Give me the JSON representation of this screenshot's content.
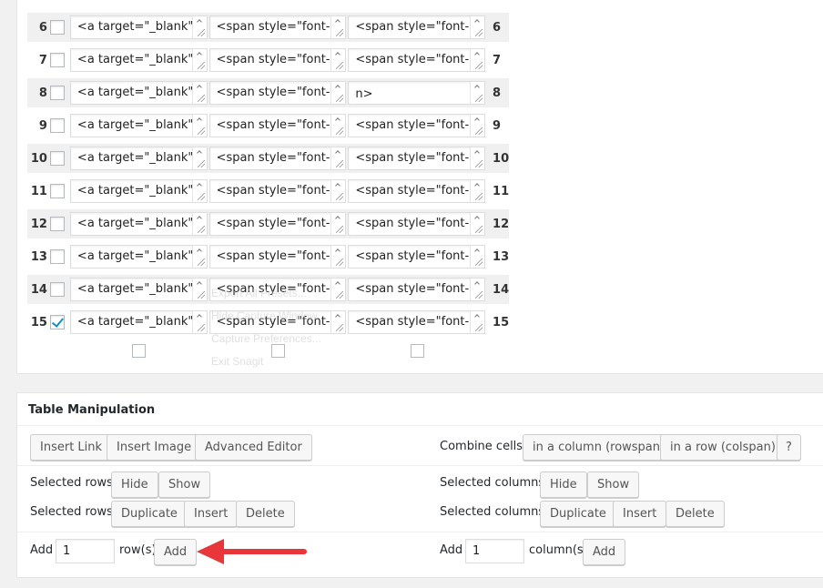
{
  "rows": [
    {
      "num": "6",
      "checked": false,
      "c1": "<a target=\"_blank\"",
      "c2": "<span style=\"font-",
      "c3": "<span style=\"font-"
    },
    {
      "num": "7",
      "checked": false,
      "c1": "<a target=\"_blank\"",
      "c2": "<span style=\"font-",
      "c3": "<span style=\"font-"
    },
    {
      "num": "8",
      "checked": false,
      "c1": "<a target=\"_blank\"",
      "c2": "<span style=\"font-",
      "c3": "n>"
    },
    {
      "num": "9",
      "checked": false,
      "c1": "<a target=\"_blank\"",
      "c2": "<span style=\"font-",
      "c3": "<span style=\"font-"
    },
    {
      "num": "10",
      "checked": false,
      "c1": "<a target=\"_blank\"",
      "c2": "<span style=\"font-",
      "c3": "<span style=\"font-"
    },
    {
      "num": "11",
      "checked": false,
      "c1": "<a target=\"_blank\"",
      "c2": "<span style=\"font-",
      "c3": "<span style=\"font-"
    },
    {
      "num": "12",
      "checked": false,
      "c1": "<a target=\"_blank\"",
      "c2": "<span style=\"font-",
      "c3": "<span style=\"font-"
    },
    {
      "num": "13",
      "checked": false,
      "c1": "<a target=\"_blank\"",
      "c2": "<span style=\"font-",
      "c3": "<span style=\"font-"
    },
    {
      "num": "14",
      "checked": false,
      "c1": "<a target=\"_blank\"",
      "c2": "<span style=\"font-",
      "c3": "<span style=\"font-"
    },
    {
      "num": "15",
      "checked": true,
      "c1": "<a target=\"_blank\"",
      "c2": "<span style=\"font-",
      "c3": "<span style=\"font-"
    }
  ],
  "ghost_menu": [
    "Export All Presets...",
    "Hide Capture Window",
    "Capture Preferences...",
    "Exit Snagit"
  ],
  "manip": {
    "title": "Table Manipulation",
    "insert_link": "Insert Link",
    "insert_image": "Insert Image",
    "advanced_editor": "Advanced Editor",
    "combine_label": "Combine cells:",
    "rowspan": "in a column (rowspan)",
    "colspan": "in a row (colspan)",
    "help": "?",
    "sel_rows_label": "Selected rows:",
    "sel_cols_label": "Selected columns:",
    "hide": "Hide",
    "show": "Show",
    "duplicate": "Duplicate",
    "insert": "Insert",
    "delete": "Delete",
    "add_label": "Add",
    "rows_value": "1",
    "rows_suffix": "row(s)",
    "cols_value": "1",
    "cols_suffix": "column(s)",
    "add_btn": "Add"
  },
  "colors": {
    "arrow": "#e8363a",
    "check": "#1e8cbe"
  }
}
